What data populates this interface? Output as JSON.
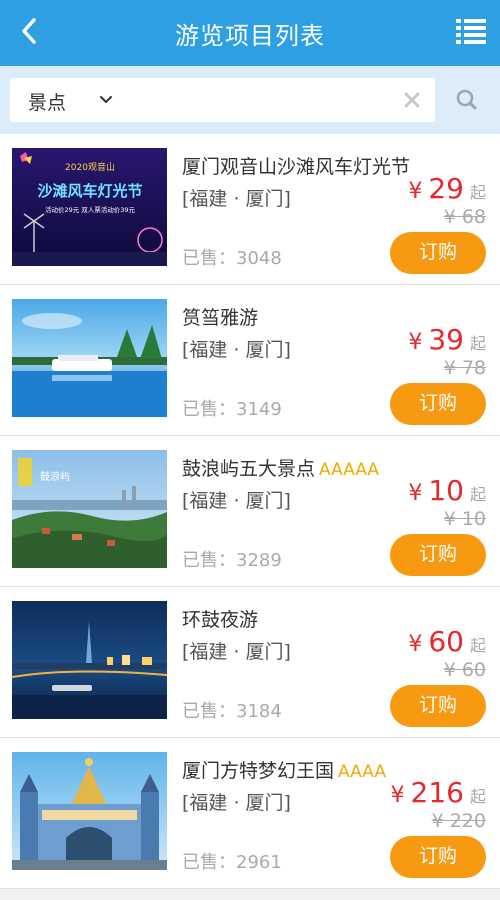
{
  "header": {
    "title": "游览项目列表",
    "back_icon": "chevron-left-icon",
    "menu_icon": "list-icon"
  },
  "search": {
    "category": "景点",
    "placeholder": ""
  },
  "colors": {
    "header": "#2d9fe2",
    "price": "#e5292e",
    "button": "#f79a12",
    "rating": "#f2a900"
  },
  "items": [
    {
      "name": "厦门观音山沙滩风车灯光节",
      "rating": "",
      "location": "[福建 · 厦门]",
      "sold": "已售：3048",
      "currency": "¥",
      "price": "29",
      "suffix": "起",
      "original": "¥ 68",
      "button": "订购",
      "image_text": {
        "line1": "2020观音山",
        "line2": "沙滩风车灯光节",
        "line3": "活动价29元  双人票活动价39元"
      }
    },
    {
      "name": "筼筜雅游",
      "rating": "",
      "location": "[福建 · 厦门]",
      "sold": "已售：3149",
      "currency": "¥",
      "price": "39",
      "suffix": "起",
      "original": "¥ 78",
      "button": "订购"
    },
    {
      "name": "鼓浪屿五大景点",
      "rating": "AAAAA",
      "location": "[福建 · 厦门]",
      "sold": "已售：3289",
      "currency": "¥",
      "price": "10",
      "suffix": "起",
      "original": "¥ 10",
      "button": "订购",
      "image_text": {
        "line1": "鼓浪屿"
      }
    },
    {
      "name": "环鼓夜游",
      "rating": "",
      "location": "[福建 · 厦门]",
      "sold": "已售：3184",
      "currency": "¥",
      "price": "60",
      "suffix": "起",
      "original": "¥ 60",
      "button": "订购"
    },
    {
      "name": "厦门方特梦幻王国",
      "rating": "AAAA",
      "location": "[福建 · 厦门]",
      "sold": "已售：2961",
      "currency": "¥",
      "price": "216",
      "suffix": "起",
      "original": "¥ 220",
      "button": "订购"
    }
  ]
}
